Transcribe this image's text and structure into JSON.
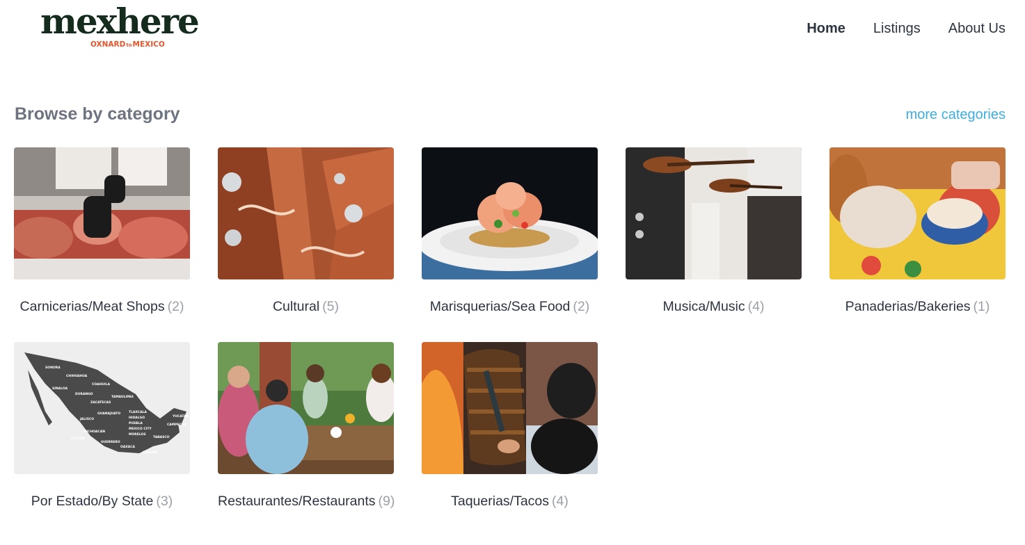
{
  "brand": {
    "name": "mexhere",
    "tagline_left": "OXNARD",
    "tagline_right": "MEXICO",
    "tagline_connector": "to"
  },
  "nav": {
    "home": "Home",
    "listings": "Listings",
    "about": "About Us"
  },
  "section": {
    "title": "Browse by category",
    "more_link": "more categories"
  },
  "map_states": [
    "SONORA",
    "CHIHUAHUA",
    "COAHUILA",
    "DURANGO",
    "ZACATECAS",
    "JALISCO",
    "GUERRERO",
    "OAXACA",
    "CHIAPAS",
    "TAMAULIPAS",
    "SINALOA",
    "MICHOACAN",
    "GUANAJUATO",
    "TLAXCALA",
    "HIDALGO",
    "PUEBLA",
    "MEXICO CITY",
    "MORELOS",
    "COLIMA",
    "YUCATAN",
    "CAMPECHE",
    "TABASCO"
  ],
  "categories": [
    {
      "name": "Carnicerias/Meat Shops",
      "count": "(2)",
      "icon": "meat-shop-photo"
    },
    {
      "name": "Cultural",
      "count": "(5)",
      "icon": "leather-saddle-photo"
    },
    {
      "name": "Marisquerias/Sea Food",
      "count": "(2)",
      "icon": "ceviche-tostada-photo"
    },
    {
      "name": "Musica/Music",
      "count": "(4)",
      "icon": "mariachi-violins-photo"
    },
    {
      "name": "Panaderias/Bakeries",
      "count": "(1)",
      "icon": "conchas-bread-photo"
    },
    {
      "name": "Por Estado/By State",
      "count": "(3)",
      "icon": "mexico-map-photo"
    },
    {
      "name": "Restaurantes/Restaurants",
      "count": "(9)",
      "icon": "restaurant-diners-photo"
    },
    {
      "name": "Taquerias/Tacos",
      "count": "(4)",
      "icon": "taco-al-pastor-photo"
    }
  ]
}
